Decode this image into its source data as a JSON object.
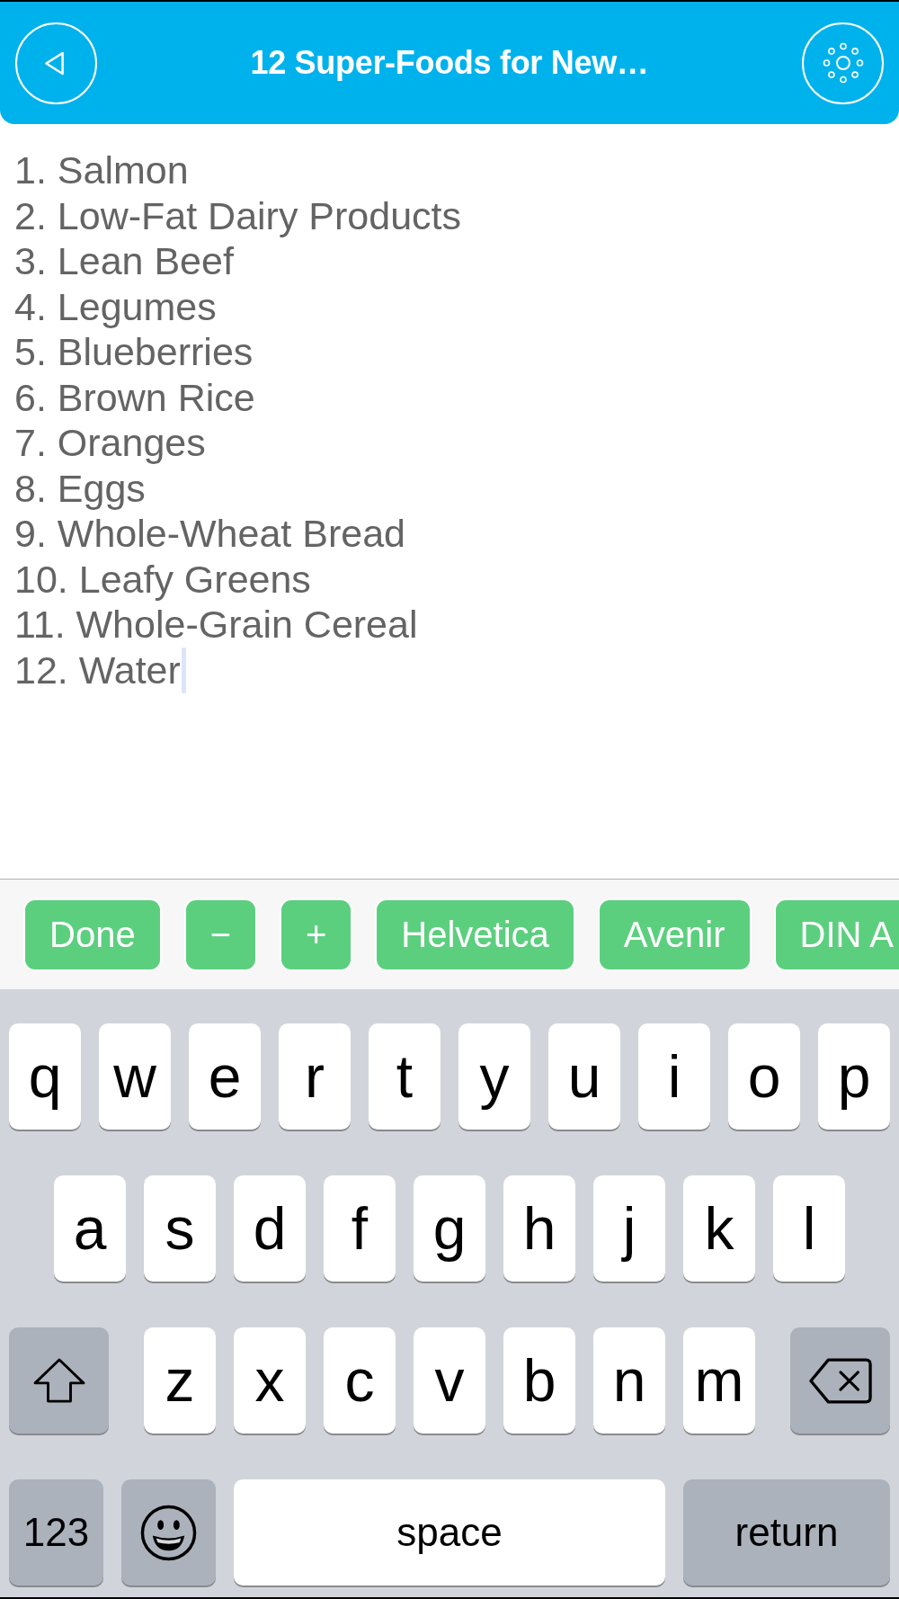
{
  "navigation_bar": {
    "title": "12 Super-Foods for New…"
  },
  "editor": {
    "lines": [
      {
        "text": "1. Salmon",
        "caret": false
      },
      {
        "text": "2. Low-Fat Dairy Products",
        "caret": false
      },
      {
        "text": "3. Lean Beef",
        "caret": false
      },
      {
        "text": "4. Legumes",
        "caret": false
      },
      {
        "text": "5. Blueberries",
        "caret": false
      },
      {
        "text": "6. Brown Rice",
        "caret": false
      },
      {
        "text": "7. Oranges",
        "caret": false
      },
      {
        "text": "8. Eggs",
        "caret": false
      },
      {
        "text": "9. Whole-Wheat Bread",
        "caret": false
      },
      {
        "text": "10. Leafy Greens",
        "caret": false
      },
      {
        "text": "11. Whole-Grain Cereal",
        "caret": false
      },
      {
        "text": "12. Water",
        "caret": true
      }
    ]
  },
  "toolbar": {
    "buttons": [
      "Done",
      "−",
      "+",
      "Helvetica",
      "Avenir",
      "DIN A"
    ]
  },
  "keyboard": {
    "rows": [
      [
        {
          "kind": "letter",
          "label": "q"
        },
        {
          "kind": "letter",
          "label": "w"
        },
        {
          "kind": "letter",
          "label": "e"
        },
        {
          "kind": "letter",
          "label": "r"
        },
        {
          "kind": "letter",
          "label": "t"
        },
        {
          "kind": "letter",
          "label": "y"
        },
        {
          "kind": "letter",
          "label": "u"
        },
        {
          "kind": "letter",
          "label": "i"
        },
        {
          "kind": "letter",
          "label": "o"
        },
        {
          "kind": "letter",
          "label": "p"
        }
      ],
      [
        {
          "kind": "letter",
          "label": "a"
        },
        {
          "kind": "letter",
          "label": "s"
        },
        {
          "kind": "letter",
          "label": "d"
        },
        {
          "kind": "letter",
          "label": "f"
        },
        {
          "kind": "letter",
          "label": "g"
        },
        {
          "kind": "letter",
          "label": "h"
        },
        {
          "kind": "letter",
          "label": "j"
        },
        {
          "kind": "letter",
          "label": "k"
        },
        {
          "kind": "letter",
          "label": "l"
        }
      ],
      [
        {
          "kind": "shift"
        },
        {
          "kind": "letter",
          "label": "z"
        },
        {
          "kind": "letter",
          "label": "x"
        },
        {
          "kind": "letter",
          "label": "c"
        },
        {
          "kind": "letter",
          "label": "v"
        },
        {
          "kind": "letter",
          "label": "b"
        },
        {
          "kind": "letter",
          "label": "n"
        },
        {
          "kind": "letter",
          "label": "m"
        },
        {
          "kind": "delete"
        }
      ]
    ],
    "bottom_row": [
      {
        "kind": "mode",
        "label": "123"
      },
      {
        "kind": "emoji"
      },
      {
        "kind": "space",
        "label": "space"
      },
      {
        "kind": "return",
        "label": "return"
      }
    ]
  }
}
